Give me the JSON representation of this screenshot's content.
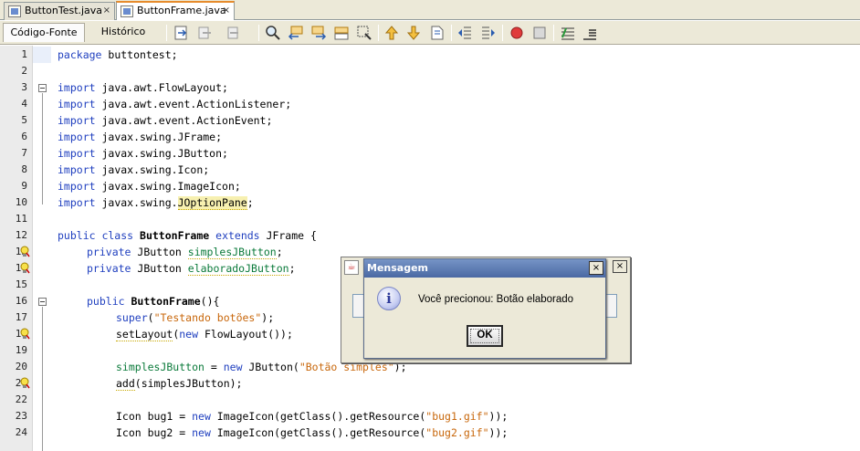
{
  "file_tabs": [
    {
      "label": "ButtonTest.java",
      "close": "×",
      "active": false
    },
    {
      "label": "ButtonFrame.java",
      "close": "×",
      "active": true
    }
  ],
  "view_tabs": [
    "Código-Fonte",
    "Histórico"
  ],
  "toolbar_icons": [
    "go-to-source-icon",
    "back-icon",
    "forward-icon",
    "find-icon",
    "find-previous-icon",
    "find-next-icon",
    "toggle-highlight-icon",
    "find-selection-icon",
    "shift-up-icon",
    "shift-down-icon",
    "toggle-bookmark-icon",
    "previous-bookmark-icon",
    "next-bookmark-icon",
    "start-macro-icon",
    "stop-macro-icon",
    "comment-icon",
    "uncomment-icon"
  ],
  "line_numbers": [
    "1",
    "2",
    "3",
    "4",
    "5",
    "6",
    "7",
    "8",
    "9",
    "10",
    "11",
    "12",
    "13",
    "14",
    "15",
    "16",
    "17",
    "18",
    "19",
    "20",
    "21",
    "22",
    "23",
    "24"
  ],
  "code": {
    "l1": {
      "kw": "package",
      "rest": " buttontest;"
    },
    "l3": {
      "kw": "import",
      "rest": " java.awt.FlowLayout;"
    },
    "l4": {
      "kw": "import",
      "rest": " java.awt.event.ActionListener;"
    },
    "l5": {
      "kw": "import",
      "rest": " java.awt.event.ActionEvent;"
    },
    "l6": {
      "kw": "import",
      "rest": " javax.swing.JFrame;"
    },
    "l7": {
      "kw": "import",
      "rest": " javax.swing.JButton;"
    },
    "l8": {
      "kw": "import",
      "rest": " javax.swing.Icon;"
    },
    "l9": {
      "kw": "import",
      "rest": " javax.swing.ImageIcon;"
    },
    "l10": {
      "kw": "import",
      "rest_a": " javax.swing.",
      "hl": "JOptionPane",
      "rest_b": ";"
    },
    "l12": {
      "kw1": "public class",
      "name": "ButtonFrame",
      "kw2": "extends",
      "rest": " JFrame {"
    },
    "l13": {
      "kw": "private",
      "type": " JButton ",
      "field": "simplesJButton",
      "end": ";"
    },
    "l14": {
      "kw": "private",
      "type": " JButton ",
      "field": "elaboradoJButton",
      "end": ";"
    },
    "l16": {
      "kw": "public",
      "name": "ButtonFrame",
      "rest": "(){"
    },
    "l17": {
      "kw": "super",
      "p1": "(",
      "str": "\"Testando botões\"",
      "p2": ");"
    },
    "l18": {
      "call": "setLayout",
      "p1": "(",
      "kw": "new",
      "rest": " FlowLayout());"
    },
    "l20": {
      "field": "simplesJButton",
      "eq": " = ",
      "kw": "new",
      "mid": " JButton(",
      "str": "\"Botão simples\"",
      "end": ");"
    },
    "l21": {
      "call": "add",
      "rest": "(simplesJButton);"
    },
    "l23": {
      "pre": "Icon bug1 = ",
      "kw": "new",
      "mid": " ImageIcon(getClass().getResource(",
      "str": "\"bug1.gif\"",
      "end": "));"
    },
    "l24": {
      "pre": "Icon bug2 = ",
      "kw": "new",
      "mid": " ImageIcon(getClass().getResource(",
      "str": "\"bug2.gif\"",
      "end": "));"
    }
  },
  "back_dialog": {
    "close": "×"
  },
  "dialog": {
    "title": "Mensagem",
    "close": "×",
    "info_glyph": "i",
    "message": "Você precionou: Botão elaborado",
    "ok_label": "OK"
  },
  "colors": {
    "keyword": "#1f3fbf",
    "string": "#c8670b",
    "title_bar": "#4a69a3",
    "margin_line": "#f3b8b8"
  }
}
